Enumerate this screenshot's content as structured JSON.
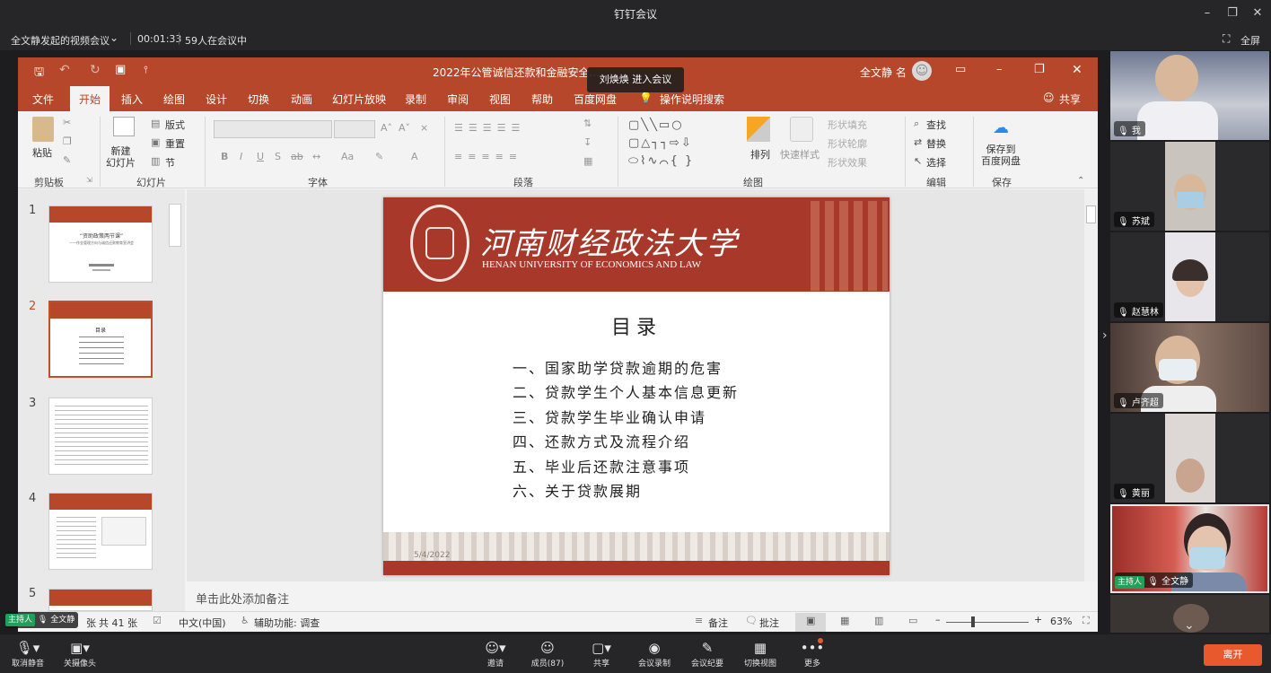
{
  "app": {
    "title": "钉钉会议",
    "fullscreen": "全屏"
  },
  "meeting": {
    "name": "全文静发起的视频会议",
    "timer": "00:01:33",
    "count": "59人在会议中"
  },
  "notification": "刘焕焕 进入会议",
  "ppt": {
    "title": "2022年公管诚信还款和金融安全...",
    "user": "全文静 名",
    "tabs": [
      "文件",
      "开始",
      "插入",
      "绘图",
      "设计",
      "切换",
      "动画",
      "幻灯片放映",
      "录制",
      "审阅",
      "视图",
      "帮助",
      "百度网盘",
      "操作说明搜索"
    ],
    "share_label": "共享",
    "ribbon": {
      "paste": "粘贴",
      "clipboard": "剪贴板",
      "new_slide": "新建\n幻灯片",
      "layout": "版式",
      "reset": "重置",
      "section": "节",
      "slides_group": "幻灯片",
      "font_group": "字体",
      "paragraph_group": "段落",
      "arrange": "排列",
      "quick_styles": "快速样式",
      "shape_fill": "形状填充",
      "shape_outline": "形状轮廓",
      "shape_effects": "形状效果",
      "drawing_group": "绘图",
      "find": "查找",
      "replace": "替换",
      "select": "选择",
      "editing_group": "编辑",
      "save_to": "保存到\n百度网盘",
      "save_group": "保存"
    },
    "slide_numbers": [
      "1",
      "2",
      "3",
      "4",
      "5"
    ],
    "thumb1_lines": [
      "“资助政策两节课”",
      "——作金管理方向与诚信还款教育宣讲会"
    ],
    "thumb2_title": "目录",
    "slide": {
      "university_cn": "河南财经政法大学",
      "university_en": "HENAN UNIVERSITY OF ECONOMICS AND LAW",
      "heading": "目录",
      "items": [
        "一、国家助学贷款逾期的危害",
        "二、贷款学生个人基本信息更新",
        "三、贷款学生毕业确认申请",
        "四、还款方式及流程介绍",
        "五、毕业后还款注意事项",
        "六、关于贷款展期"
      ],
      "date": "5/4/2022"
    },
    "notes_placeholder": "单击此处添加备注",
    "status": {
      "slide_count": "共 41 张",
      "fragment": "张",
      "language": "中文(中国)",
      "accessibility": "辅助功能: 调查",
      "notes": "备注",
      "comments": "批注",
      "zoom": "63%"
    }
  },
  "participants": [
    {
      "name": "我",
      "mic": "on"
    },
    {
      "name": "苏斌",
      "mic": "on"
    },
    {
      "name": "赵慧林",
      "mic": "on"
    },
    {
      "name": "卢齐超",
      "mic": "on"
    },
    {
      "name": "黄丽",
      "mic": "on"
    },
    {
      "name": "全文静",
      "role": "主持人",
      "mic": "on"
    }
  ],
  "host_overlay": {
    "role": "主持人",
    "name": "全文静"
  },
  "toolbar": {
    "mute": "取消静音",
    "camera": "关摄像头",
    "invite": "邀请",
    "members": "成员(87)",
    "share": "共享",
    "record": "会议录制",
    "minutes": "会议纪要",
    "switch_view": "切换视图",
    "more": "更多",
    "leave": "离开"
  },
  "colors": {
    "ppt_brand": "#b7472a",
    "leave": "#e85a2d",
    "host_green": "#20a05a"
  }
}
